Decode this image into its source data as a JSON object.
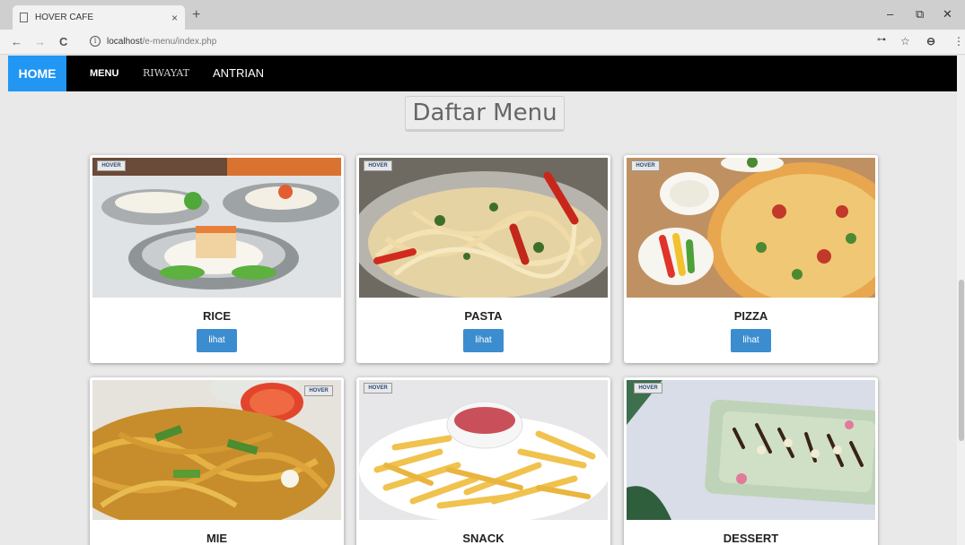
{
  "browser": {
    "tab_title": "HOVER CAFE",
    "tab_close": "×",
    "new_tab": "+",
    "url_host": "localhost",
    "url_path": "/e-menu/index.php",
    "back": "←",
    "forward": "→",
    "reload": "C",
    "info": "i",
    "key": "⊶",
    "star": "☆",
    "profile": "⊖",
    "more": "⋮",
    "minimize": "–",
    "restore": "⧉",
    "close": "✕"
  },
  "nav": {
    "home": "HOME",
    "menu": "MENU",
    "riwayat": "RIWAYAT",
    "antrian": "ANTRIAN"
  },
  "page": {
    "title": "Daftar Menu"
  },
  "logo_text": "HOVER",
  "button_label": "lihat",
  "menu": [
    {
      "name": "RICE",
      "image": "rice-dish"
    },
    {
      "name": "PASTA",
      "image": "spaghetti-dish"
    },
    {
      "name": "PIZZA",
      "image": "pizza-dish"
    },
    {
      "name": "MIE",
      "image": "fried-noodles-dish"
    },
    {
      "name": "SNACK",
      "image": "french-fries-dish"
    },
    {
      "name": "DESSERT",
      "image": "dessert-plate"
    }
  ],
  "colors": {
    "accent": "#2196f3",
    "button": "#3c8dcf",
    "navbar": "#000000"
  }
}
